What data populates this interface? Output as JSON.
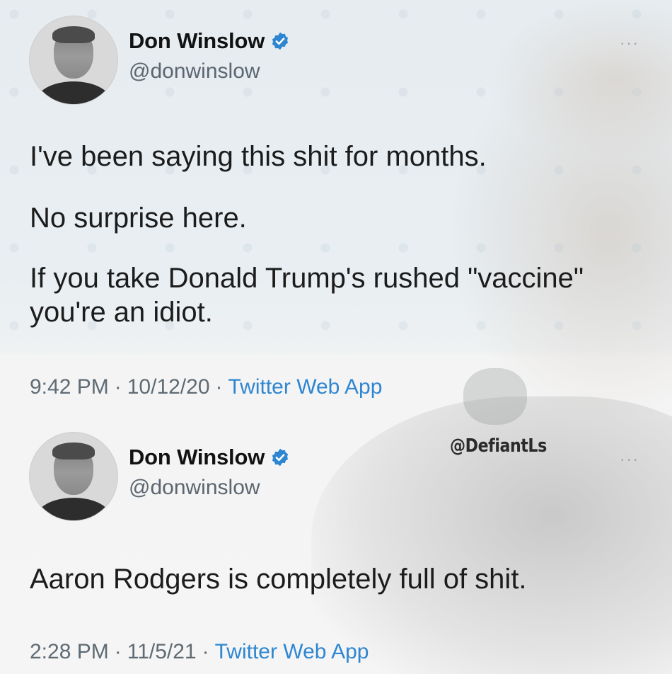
{
  "tweets": [
    {
      "author_name": "Don Winslow",
      "handle": "@donwinslow",
      "more_label": "···",
      "lines": [
        "I've been saying this shit for months.",
        "No surprise here.",
        "If you take Donald Trump's rushed \"vaccine\" you're an idiot."
      ],
      "time": "9:42 PM",
      "date": "10/12/20",
      "source": "Twitter Web App",
      "separator": "·"
    },
    {
      "author_name": "Don Winslow",
      "handle": "@donwinslow",
      "more_label": "···",
      "lines": [
        "Aaron Rodgers is completely full of shit."
      ],
      "time": "2:28 PM",
      "date": "11/5/21",
      "source": "Twitter Web App",
      "separator": "·"
    }
  ],
  "watermark": "@DefiantLs",
  "colors": {
    "verified": "#2f86d0",
    "link": "#2f86d0",
    "meta_text": "#5f6b74"
  },
  "icons": {
    "verified": "verified-badge-icon",
    "more": "more-options-icon"
  }
}
